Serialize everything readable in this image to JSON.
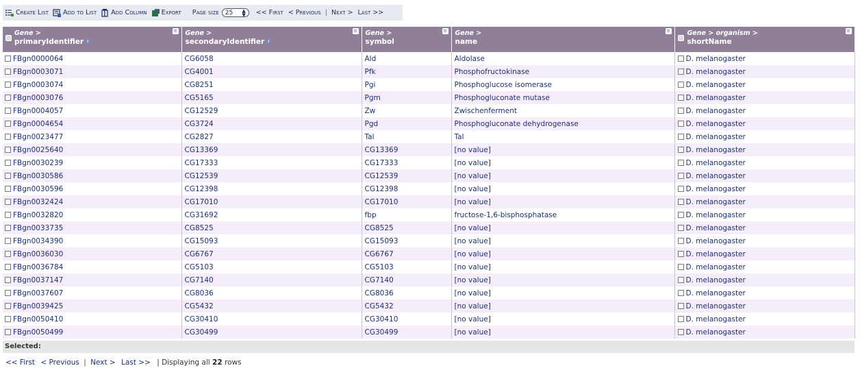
{
  "toolbar": {
    "create_list": "Create List",
    "add_to_list": "Add to List",
    "add_column": "Add Column",
    "export": "Export",
    "page_size_label": "Page size",
    "page_size_value": "25",
    "first": "<< First",
    "previous": "< Previous",
    "next": "Next >",
    "last": "Last >>"
  },
  "columns": [
    {
      "top": "Gene >",
      "bottom": "primaryIdentifier"
    },
    {
      "top": "Gene >",
      "bottom": "secondaryIdentifier"
    },
    {
      "top": "Gene >",
      "bottom": "symbol"
    },
    {
      "top": "Gene >",
      "bottom": "name"
    },
    {
      "top": "Gene > organism >",
      "bottom": "shortName"
    }
  ],
  "rows": [
    [
      "FBgn0000064",
      "CG6058",
      "Ald",
      "Aldolase",
      "D. melanogaster"
    ],
    [
      "FBgn0003071",
      "CG4001",
      "Pfk",
      "Phosphofructokinase",
      "D. melanogaster"
    ],
    [
      "FBgn0003074",
      "CG8251",
      "Pgi",
      "Phosphoglucose isomerase",
      "D. melanogaster"
    ],
    [
      "FBgn0003076",
      "CG5165",
      "Pgm",
      "Phosphogluconate mutase",
      "D. melanogaster"
    ],
    [
      "FBgn0004057",
      "CG12529",
      "Zw",
      "Zwischenferment",
      "D. melanogaster"
    ],
    [
      "FBgn0004654",
      "CG3724",
      "Pgd",
      "Phosphogluconate dehydrogenase",
      "D. melanogaster"
    ],
    [
      "FBgn0023477",
      "CG2827",
      "Tal",
      "Tal",
      "D. melanogaster"
    ],
    [
      "FBgn0025640",
      "CG13369",
      "CG13369",
      "[no value]",
      "D. melanogaster"
    ],
    [
      "FBgn0030239",
      "CG17333",
      "CG17333",
      "[no value]",
      "D. melanogaster"
    ],
    [
      "FBgn0030586",
      "CG12539",
      "CG12539",
      "[no value]",
      "D. melanogaster"
    ],
    [
      "FBgn0030596",
      "CG12398",
      "CG12398",
      "[no value]",
      "D. melanogaster"
    ],
    [
      "FBgn0032424",
      "CG17010",
      "CG17010",
      "[no value]",
      "D. melanogaster"
    ],
    [
      "FBgn0032820",
      "CG31692",
      "fbp",
      "fructose-1,6-bisphosphatase",
      "D. melanogaster"
    ],
    [
      "FBgn0033735",
      "CG8525",
      "CG8525",
      "[no value]",
      "D. melanogaster"
    ],
    [
      "FBgn0034390",
      "CG15093",
      "CG15093",
      "[no value]",
      "D. melanogaster"
    ],
    [
      "FBgn0036030",
      "CG6767",
      "CG6767",
      "[no value]",
      "D. melanogaster"
    ],
    [
      "FBgn0036784",
      "CG5103",
      "CG5103",
      "[no value]",
      "D. melanogaster"
    ],
    [
      "FBgn0037147",
      "CG7140",
      "CG7140",
      "[no value]",
      "D. melanogaster"
    ],
    [
      "FBgn0037607",
      "CG8036",
      "CG8036",
      "[no value]",
      "D. melanogaster"
    ],
    [
      "FBgn0039425",
      "CG5432",
      "CG5432",
      "[no value]",
      "D. melanogaster"
    ],
    [
      "FBgn0050410",
      "CG30410",
      "CG30410",
      "[no value]",
      "D. melanogaster"
    ],
    [
      "FBgn0050499",
      "CG30499",
      "CG30499",
      "[no value]",
      "D. melanogaster"
    ]
  ],
  "selected_label": "Selected:",
  "bottom": {
    "first": "<< First",
    "previous": "< Previous",
    "next": "Next >",
    "last": "Last >>",
    "displaying_prefix": "| Displaying all",
    "count": "22",
    "rows_suffix": "rows"
  },
  "colors": {
    "header_bg": "#8f7f98",
    "row_alt": "#f5eefa",
    "link": "#1d2f72"
  }
}
